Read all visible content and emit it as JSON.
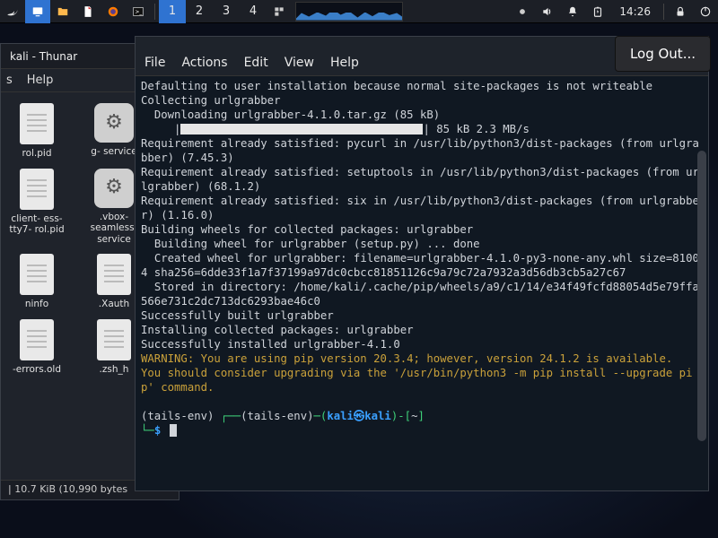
{
  "panel": {
    "workspaces": [
      "1",
      "2",
      "3",
      "4"
    ],
    "active_workspace": 0,
    "clock": "14:26"
  },
  "logout_label": "Log Out...",
  "thunar": {
    "title": "kali - Thunar",
    "menus": [
      "s",
      "Help"
    ],
    "files": [
      {
        "name": "rol.pid",
        "icon": "doc"
      },
      {
        "name": "g-\nservice",
        "icon": "gear"
      },
      {
        "name": "client-\ness-tty7-\nrol.pid",
        "icon": "doc"
      },
      {
        "name": ".vbox-\nseamless-\nservice",
        "icon": "gear"
      },
      {
        "name": "ninfo",
        "icon": "doc"
      },
      {
        "name": ".Xauth",
        "icon": "doc"
      },
      {
        "name": "-errors.old",
        "icon": "doc"
      },
      {
        "name": ".zsh_h",
        "icon": "doc"
      }
    ],
    "status": "|  10.7 KiB (10,990 bytes"
  },
  "terminal": {
    "menus": [
      "File",
      "Actions",
      "Edit",
      "View",
      "Help"
    ],
    "lines": {
      "l1": "Defaulting to user installation because normal site-packages is not writeable",
      "l2": "Collecting urlgrabber",
      "l3": "  Downloading urlgrabber-4.1.0.tar.gz (85 kB)",
      "l4_suffix": " 85 kB 2.3 MB/s",
      "l5": "Requirement already satisfied: pycurl in /usr/lib/python3/dist-packages (from urlgrabber) (7.45.3)",
      "l6": "Requirement already satisfied: setuptools in /usr/lib/python3/dist-packages (from urlgrabber) (68.1.2)",
      "l7": "Requirement already satisfied: six in /usr/lib/python3/dist-packages (from urlgrabber) (1.16.0)",
      "l8": "Building wheels for collected packages: urlgrabber",
      "l9": "  Building wheel for urlgrabber (setup.py) ... done",
      "l10": "  Created wheel for urlgrabber: filename=urlgrabber-4.1.0-py3-none-any.whl size=81004 sha256=6dde33f1a7f37199a97dc0cbcc81851126c9a79c72a7932a3d56db3cb5a27c67",
      "l11": "  Stored in directory: /home/kali/.cache/pip/wheels/a9/c1/14/e34f49fcfd88054d5e79ffa566e731c2dc713dc6293bae46c0",
      "l12": "Successfully built urlgrabber",
      "l13": "Installing collected packages: urlgrabber",
      "l14": "Successfully installed urlgrabber-4.1.0",
      "warn1": "WARNING: You are using pip version 20.3.4; however, version 24.1.2 is available.",
      "warn2": "You should consider upgrading via the '/usr/bin/python3 -m pip install --upgrade pip' command.",
      "prompt_env": "(tails-env) ",
      "prompt_paren_env": "(tails-env)",
      "prompt_userhost": "kali㉿kali",
      "prompt_path": "~",
      "prompt_dollar": "$"
    }
  }
}
